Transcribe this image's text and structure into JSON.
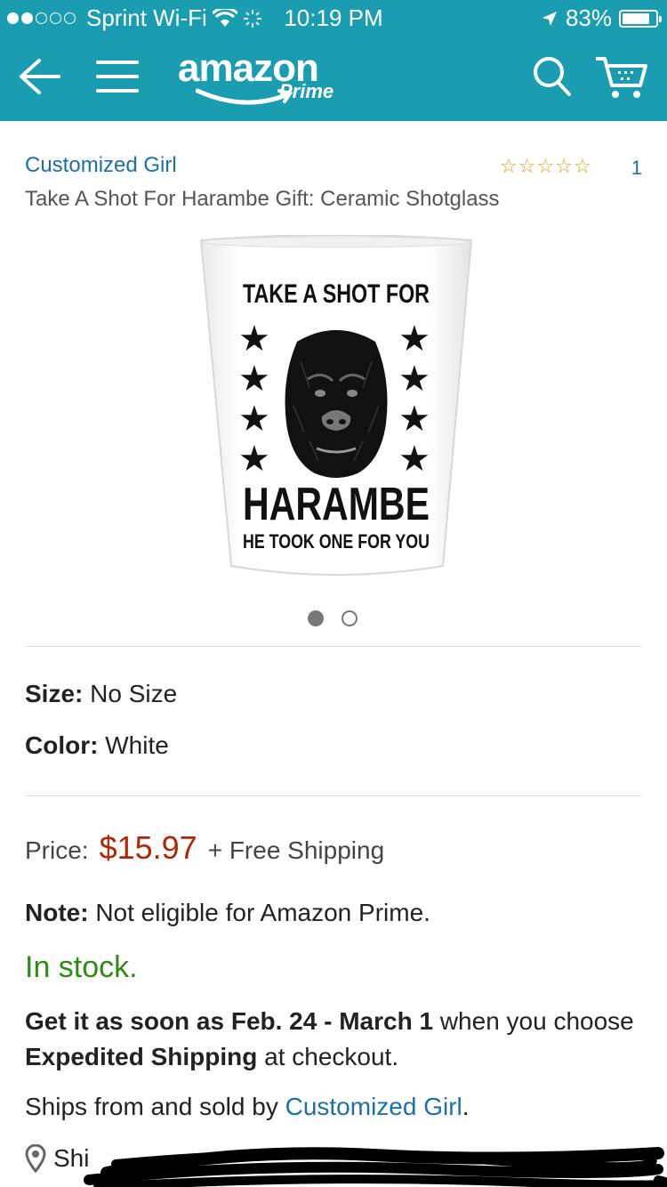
{
  "status_bar": {
    "carrier": "Sprint Wi-Fi",
    "time": "10:19 PM",
    "battery": "83%",
    "battery_level": 0.83
  },
  "nav": {
    "logo_text": "amazon",
    "logo_sub": "Prime"
  },
  "product": {
    "brand": "Customized Girl",
    "rating_stars": 5,
    "review_count": "1",
    "title": "Take A Shot For Harambe Gift: Ceramic Shotglass",
    "image_text": {
      "line1": "TAKE A SHOT FOR",
      "line2": "HARAMBE",
      "line3": "HE TOOK ONE FOR YOU"
    },
    "carousel": {
      "count": 2,
      "active": 0
    }
  },
  "variations": [
    {
      "label": "Size:",
      "value": "No Size"
    },
    {
      "label": "Color:",
      "value": "White"
    }
  ],
  "pricing": {
    "price_label": "Price:",
    "price": "$15.97",
    "shipping": "+ Free Shipping"
  },
  "note": {
    "label": "Note:",
    "text": "Not eligible for Amazon Prime."
  },
  "availability": "In stock.",
  "delivery": {
    "prefix": "Get it as soon as Feb. 24 - March 1",
    "mid": " when you choose ",
    "method": "Expedited Shipping",
    "suffix": " at checkout."
  },
  "ships_from": {
    "prefix": "Ships from and sold by ",
    "seller": "Customized Girl",
    "suffix": "."
  },
  "ship_to": {
    "text": "Shi"
  },
  "colors": {
    "header": "#1a9db0",
    "link": "#1e6fa8",
    "price": "#b12704",
    "in_stock": "#2d8a14",
    "star": "#e69b0e"
  }
}
